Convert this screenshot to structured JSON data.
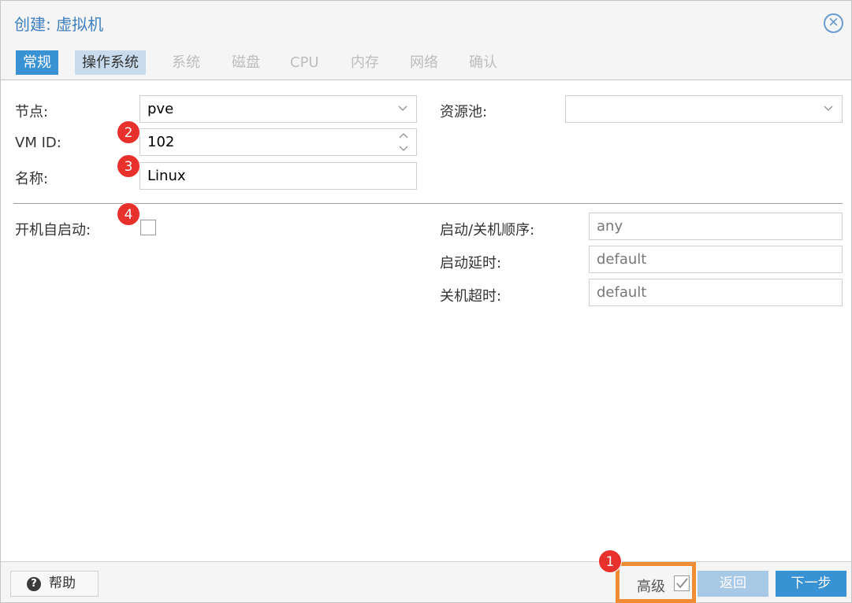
{
  "window": {
    "title": "创建: 虚拟机",
    "close_glyph": "✕"
  },
  "tabs": [
    {
      "label": "常规",
      "state": "active"
    },
    {
      "label": "操作系统",
      "state": "visited"
    },
    {
      "label": "系统",
      "state": "disabled"
    },
    {
      "label": "磁盘",
      "state": "disabled"
    },
    {
      "label": "CPU",
      "state": "disabled"
    },
    {
      "label": "内存",
      "state": "disabled"
    },
    {
      "label": "网络",
      "state": "disabled"
    },
    {
      "label": "确认",
      "state": "disabled"
    }
  ],
  "form": {
    "node": {
      "label": "节点:",
      "value": "pve"
    },
    "pool": {
      "label": "资源池:",
      "value": ""
    },
    "vmid": {
      "label": "VM ID:",
      "value": "102"
    },
    "name": {
      "label": "名称:",
      "value": "Linux"
    },
    "autostart": {
      "label": "开机自启动:",
      "checked": false
    },
    "boot_order": {
      "label": "启动/关机顺序:",
      "placeholder": "any"
    },
    "startup_delay": {
      "label": "启动延时:",
      "placeholder": "default"
    },
    "shutdown_timeout": {
      "label": "关机超时:",
      "placeholder": "default"
    }
  },
  "annotations": {
    "b1": "1",
    "b2": "2",
    "b3": "3",
    "b4": "4"
  },
  "footer": {
    "help_icon": "?",
    "help_label": "帮助",
    "advanced_label": "高级",
    "advanced_checked": true,
    "back_label": "返回",
    "next_label": "下一步"
  },
  "colors": {
    "accent": "#3892d4",
    "badge": "#e8302d",
    "highlight": "#f08d33"
  }
}
